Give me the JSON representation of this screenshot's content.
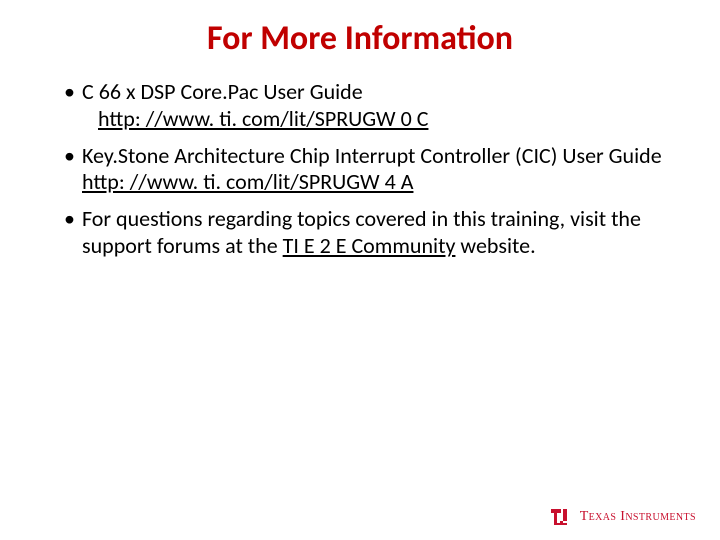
{
  "title": "For More Information",
  "bullets": {
    "b1_text": "C 66 x DSP Core.Pac User Guide",
    "b1_link": "http: //www. ti. com/lit/SPRUGW 0 C",
    "b2_text_a": "Key.Stone Architecture Chip Interrupt Controller (CIC) User Guide ",
    "b2_link": "http: //www. ti. com/lit/SPRUGW 4 A",
    "b3_text_a": "For questions regarding topics covered in this training, visit the support forums at the ",
    "b3_link": "TI E 2 E Community",
    "b3_text_b": " website."
  },
  "footer": {
    "brand": "Texas Instruments"
  }
}
